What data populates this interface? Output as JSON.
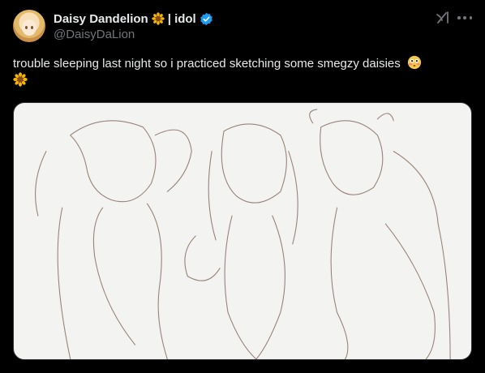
{
  "author": {
    "display_name": "Daisy Dandelion",
    "separator": "| idol",
    "handle": "@DaisyDaLion",
    "icons": [
      "sunflower-emoji-icon",
      "verified-badge-icon"
    ]
  },
  "tweet": {
    "text": "trouble sleeping last night so i practiced sketching some smegzy daisies",
    "trailing_emojis": [
      "flushed-face-emoji-icon",
      "sunflower-emoji-icon"
    ]
  },
  "colors": {
    "background": "#000000",
    "primary_text": "#e7e9ea",
    "secondary_text": "#71767b",
    "verified_blue": "#1d9bf0",
    "sketch_bg": "#f3f3f2",
    "sketch_line": "#8a6f63"
  },
  "media": {
    "kind": "pencil sketch image"
  }
}
